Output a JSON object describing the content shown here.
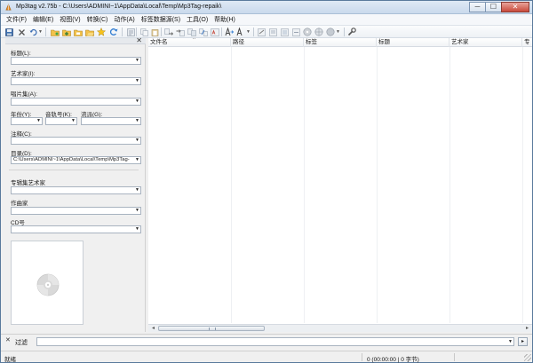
{
  "window": {
    "title": "Mp3tag v2.75b  -  C:\\Users\\ADMINI~1\\AppData\\Local\\Temp\\Mp3Tag-repaik\\",
    "icon": "mp3tag-app-icon"
  },
  "window_controls": {
    "minimize": "─",
    "maximize": "☐",
    "close": "✕"
  },
  "menu": [
    {
      "label": "文件(F)"
    },
    {
      "label": "编辑(E)"
    },
    {
      "label": "视图(V)"
    },
    {
      "label": "转换(C)"
    },
    {
      "label": "动作(A)"
    },
    {
      "label": "标签数据源(S)"
    },
    {
      "label": "工具(O)"
    },
    {
      "label": "帮助(H)"
    }
  ],
  "toolbar": {
    "icons": [
      "save-icon",
      "remove-tag-icon",
      "undo-icon",
      "change-directory-icon",
      "add-directory-icon",
      "favorite-folders-icon",
      "open-folder-icon",
      "star-favorite-icon",
      "refresh-icon",
      "select-all-icon",
      "copy-tag-icon",
      "paste-tag-icon",
      "tag-to-filename-icon",
      "filename-to-tag-icon",
      "text-to-tag-icon",
      "tag-to-tag-icon",
      "auto-number-icon",
      "actions-icon",
      "cut-icon",
      "export-icon",
      "playlist-icon",
      "web-sources-icon",
      "freedb-icon",
      "discogs-icon",
      "tools-icon"
    ]
  },
  "tag_panel": {
    "close_glyph": "✕",
    "fields": [
      {
        "label": "标题(L):",
        "value": ""
      },
      {
        "label": "艺术家(I):",
        "value": ""
      },
      {
        "label": "唱片集(A):",
        "value": ""
      },
      {
        "label": "年份(Y):",
        "value": ""
      },
      {
        "label": "音轨号(K):",
        "value": ""
      },
      {
        "label": "流派(G):",
        "value": ""
      },
      {
        "label": "注释(C):",
        "value": ""
      },
      {
        "label": "目录(D):",
        "value": "C:\\Users\\ADMINI~1\\AppData\\Local\\Temp\\Mp3Tag-"
      },
      {
        "label": "专辑集艺术家",
        "value": ""
      },
      {
        "label": "作曲家",
        "value": ""
      },
      {
        "label": "CD号",
        "value": ""
      }
    ],
    "cover_art": "disc-placeholder-icon"
  },
  "file_list": {
    "columns": [
      "文件名",
      "路径",
      "标签",
      "标题",
      "艺术家",
      "专"
    ],
    "sorted_column": "文件名",
    "rows": []
  },
  "filter": {
    "close_glyph": "✕",
    "label": "过滤",
    "value": "",
    "go_glyph": "▸"
  },
  "status": {
    "left": "就绪",
    "right": "0 (00:00:00 | 0 字节)"
  },
  "colors": {
    "titlebar": "#c9d9ec",
    "window_bg": "#f0f0f0",
    "list_bg": "#ffffff",
    "close_button": "#c94a3b"
  }
}
